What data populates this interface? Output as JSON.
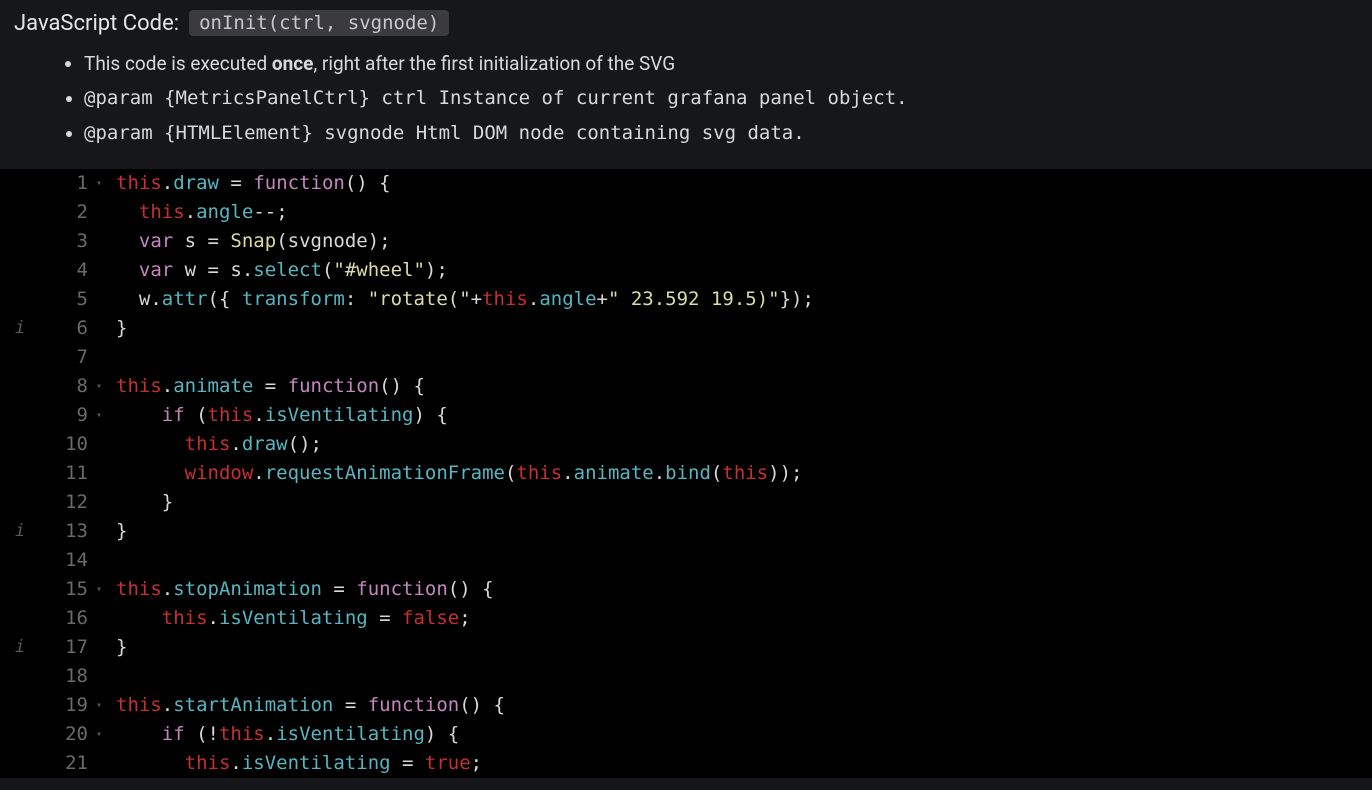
{
  "header": {
    "title": "JavaScript Code:",
    "fn_signature": "onInit(ctrl, svgnode)",
    "bullets": [
      {
        "pre": "This code is executed ",
        "bold": "once",
        "post": ", right after the first initialization of the SVG"
      },
      {
        "text": "@param   {MetricsPanelCtrl}   ctrl   Instance of current grafana panel object."
      },
      {
        "text": "@param   {HTMLElement}   svgnode   Html DOM node containing svg data."
      }
    ]
  },
  "editor": {
    "info_markers": {
      "6": "i",
      "13": "i",
      "17": "i"
    },
    "fold_markers": {
      "1": true,
      "8": true,
      "9": true,
      "15": true,
      "19": true,
      "20": true
    },
    "lines": [
      [
        {
          "t": "this",
          "c": "this"
        },
        {
          "t": ".",
          "c": "pun"
        },
        {
          "t": "draw",
          "c": "prop"
        },
        {
          "t": " = ",
          "c": "pun"
        },
        {
          "t": "function",
          "c": "kw"
        },
        {
          "t": "() {",
          "c": "pun"
        }
      ],
      [
        {
          "t": "  ",
          "c": "pun"
        },
        {
          "t": "this",
          "c": "this"
        },
        {
          "t": ".",
          "c": "pun"
        },
        {
          "t": "angle",
          "c": "prop"
        },
        {
          "t": "--;",
          "c": "pun"
        }
      ],
      [
        {
          "t": "  ",
          "c": "pun"
        },
        {
          "t": "var",
          "c": "kw"
        },
        {
          "t": " s = ",
          "c": "pun"
        },
        {
          "t": "Snap",
          "c": "fn"
        },
        {
          "t": "(svgnode);",
          "c": "pun"
        }
      ],
      [
        {
          "t": "  ",
          "c": "pun"
        },
        {
          "t": "var",
          "c": "kw"
        },
        {
          "t": " w = s.",
          "c": "pun"
        },
        {
          "t": "select",
          "c": "prop"
        },
        {
          "t": "(",
          "c": "pun"
        },
        {
          "t": "\"#wheel\"",
          "c": "str"
        },
        {
          "t": ");",
          "c": "pun"
        }
      ],
      [
        {
          "t": "  w.",
          "c": "pun"
        },
        {
          "t": "attr",
          "c": "prop"
        },
        {
          "t": "({ ",
          "c": "pun"
        },
        {
          "t": "transform",
          "c": "prop"
        },
        {
          "t": ": ",
          "c": "pun"
        },
        {
          "t": "\"rotate(\"",
          "c": "str"
        },
        {
          "t": "+",
          "c": "pun"
        },
        {
          "t": "this",
          "c": "this"
        },
        {
          "t": ".",
          "c": "pun"
        },
        {
          "t": "angle",
          "c": "prop"
        },
        {
          "t": "+",
          "c": "pun"
        },
        {
          "t": "\" 23.592 19.5)\"",
          "c": "str"
        },
        {
          "t": "});",
          "c": "pun"
        }
      ],
      [
        {
          "t": "}",
          "c": "pun"
        }
      ],
      [
        {
          "t": "",
          "c": "pun"
        }
      ],
      [
        {
          "t": "this",
          "c": "this"
        },
        {
          "t": ".",
          "c": "pun"
        },
        {
          "t": "animate",
          "c": "prop"
        },
        {
          "t": " = ",
          "c": "pun"
        },
        {
          "t": "function",
          "c": "kw"
        },
        {
          "t": "() {",
          "c": "pun"
        }
      ],
      [
        {
          "t": "    ",
          "c": "pun"
        },
        {
          "t": "if",
          "c": "kw"
        },
        {
          "t": " (",
          "c": "pun"
        },
        {
          "t": "this",
          "c": "this"
        },
        {
          "t": ".",
          "c": "pun"
        },
        {
          "t": "isVentilating",
          "c": "prop"
        },
        {
          "t": ") {",
          "c": "pun"
        }
      ],
      [
        {
          "t": "      ",
          "c": "pun"
        },
        {
          "t": "this",
          "c": "this"
        },
        {
          "t": ".",
          "c": "pun"
        },
        {
          "t": "draw",
          "c": "prop"
        },
        {
          "t": "();",
          "c": "pun"
        }
      ],
      [
        {
          "t": "      ",
          "c": "pun"
        },
        {
          "t": "window",
          "c": "this"
        },
        {
          "t": ".",
          "c": "pun"
        },
        {
          "t": "requestAnimationFrame",
          "c": "prop"
        },
        {
          "t": "(",
          "c": "pun"
        },
        {
          "t": "this",
          "c": "this"
        },
        {
          "t": ".",
          "c": "pun"
        },
        {
          "t": "animate",
          "c": "prop"
        },
        {
          "t": ".",
          "c": "pun"
        },
        {
          "t": "bind",
          "c": "prop"
        },
        {
          "t": "(",
          "c": "pun"
        },
        {
          "t": "this",
          "c": "this"
        },
        {
          "t": "));",
          "c": "pun"
        }
      ],
      [
        {
          "t": "    }",
          "c": "pun"
        }
      ],
      [
        {
          "t": "}",
          "c": "pun"
        }
      ],
      [
        {
          "t": "",
          "c": "pun"
        }
      ],
      [
        {
          "t": "this",
          "c": "this"
        },
        {
          "t": ".",
          "c": "pun"
        },
        {
          "t": "stopAnimation",
          "c": "prop"
        },
        {
          "t": " = ",
          "c": "pun"
        },
        {
          "t": "function",
          "c": "kw"
        },
        {
          "t": "() {",
          "c": "pun"
        }
      ],
      [
        {
          "t": "    ",
          "c": "pun"
        },
        {
          "t": "this",
          "c": "this"
        },
        {
          "t": ".",
          "c": "pun"
        },
        {
          "t": "isVentilating",
          "c": "prop"
        },
        {
          "t": " = ",
          "c": "pun"
        },
        {
          "t": "false",
          "c": "bool"
        },
        {
          "t": ";",
          "c": "pun"
        }
      ],
      [
        {
          "t": "}",
          "c": "pun"
        }
      ],
      [
        {
          "t": "",
          "c": "pun"
        }
      ],
      [
        {
          "t": "this",
          "c": "this"
        },
        {
          "t": ".",
          "c": "pun"
        },
        {
          "t": "startAnimation",
          "c": "prop"
        },
        {
          "t": " = ",
          "c": "pun"
        },
        {
          "t": "function",
          "c": "kw"
        },
        {
          "t": "() {",
          "c": "pun"
        }
      ],
      [
        {
          "t": "    ",
          "c": "pun"
        },
        {
          "t": "if",
          "c": "kw"
        },
        {
          "t": " (!",
          "c": "pun"
        },
        {
          "t": "this",
          "c": "this"
        },
        {
          "t": ".",
          "c": "pun"
        },
        {
          "t": "isVentilating",
          "c": "prop"
        },
        {
          "t": ") {",
          "c": "pun"
        }
      ],
      [
        {
          "t": "      ",
          "c": "pun"
        },
        {
          "t": "this",
          "c": "this"
        },
        {
          "t": ".",
          "c": "pun"
        },
        {
          "t": "isVentilating",
          "c": "prop"
        },
        {
          "t": " = ",
          "c": "pun"
        },
        {
          "t": "true",
          "c": "bool"
        },
        {
          "t": ";",
          "c": "pun"
        }
      ]
    ]
  }
}
